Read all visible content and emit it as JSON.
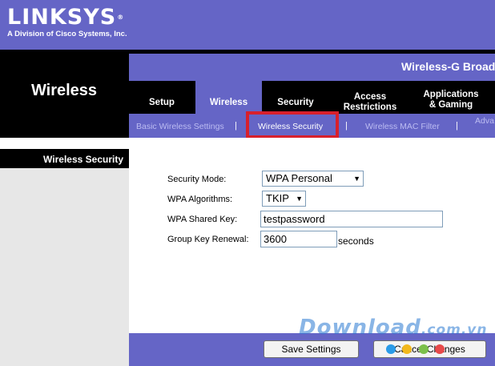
{
  "brand": {
    "logo": "LINKSYS",
    "registered": "®",
    "subtitle": "A Division of Cisco Systems, Inc."
  },
  "header": {
    "section_title": "Wireless",
    "product_name": "Wireless-G Broadb"
  },
  "tabs": [
    {
      "label": "Setup"
    },
    {
      "label": "Wireless"
    },
    {
      "label": "Security"
    },
    {
      "label_line1": "Access",
      "label_line2": "Restrictions"
    },
    {
      "label_line1": "Applications",
      "label_line2": "& Gaming"
    }
  ],
  "subnav": {
    "items": [
      "Basic Wireless Settings",
      "Wireless Security",
      "Wireless MAC Filter",
      "Adva"
    ],
    "separator": "|"
  },
  "left_panel": {
    "heading": "Wireless Security"
  },
  "form": {
    "security_mode": {
      "label": "Security Mode:",
      "value": "WPA Personal"
    },
    "wpa_algorithms": {
      "label": "WPA Algorithms:",
      "value": "TKIP"
    },
    "wpa_shared_key": {
      "label": "WPA Shared  Key:",
      "value": "testpassword"
    },
    "group_key_renewal": {
      "label": "Group Key  Renewal:",
      "value": "3600",
      "unit": "seconds"
    }
  },
  "buttons": {
    "save": "Save Settings",
    "cancel": "Cancel Changes"
  },
  "watermark": {
    "text": "Download",
    "suffix": ".com.vn"
  },
  "colors": {
    "nav_purple": "#6565c6",
    "highlight_red": "#d8202c",
    "panel_gray": "#e7e7e7"
  },
  "icons": {
    "dropdown": "triangle-down"
  }
}
